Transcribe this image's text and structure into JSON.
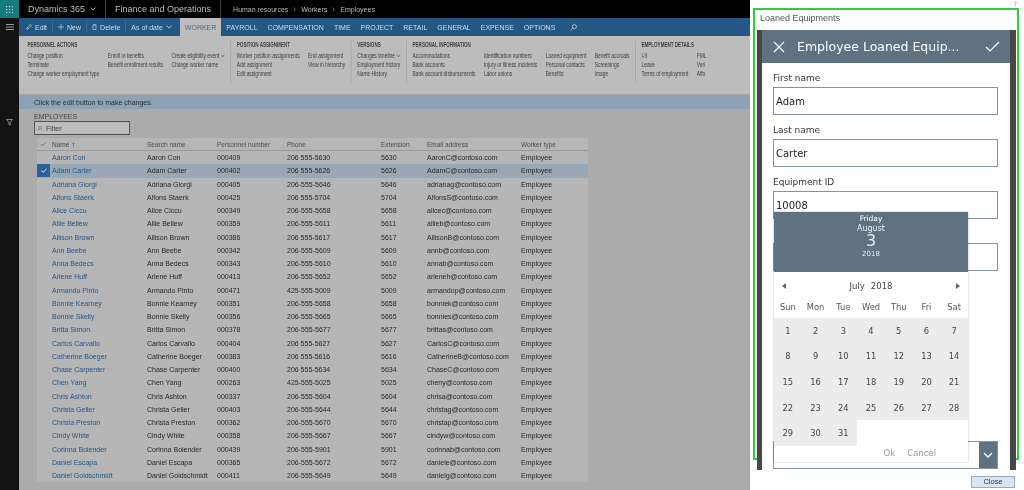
{
  "top_bar": {
    "app": "Dynamics 365",
    "module": "Finance and Operations",
    "breadcrumb": [
      "Human resources",
      "Workers",
      "Employees"
    ]
  },
  "action_bar": {
    "commands": [
      {
        "label": "Edit",
        "menu": false
      },
      {
        "label": "New",
        "menu": false
      },
      {
        "label": "Delete",
        "menu": false
      },
      {
        "label": "As of date",
        "menu": true
      }
    ],
    "tabs": [
      {
        "label": "WORKER",
        "selected": true
      },
      {
        "label": "PAYROLL",
        "selected": false
      },
      {
        "label": "COMPENSATION",
        "selected": false
      },
      {
        "label": "TIME",
        "selected": false
      },
      {
        "label": "PROJECT",
        "selected": false
      },
      {
        "label": "RETAIL",
        "selected": false
      },
      {
        "label": "GENERAL",
        "selected": false
      },
      {
        "label": "EXPENSE",
        "selected": false
      },
      {
        "label": "OPTIONS",
        "selected": false
      }
    ]
  },
  "ribbon": {
    "groups": [
      {
        "title": "PERSONNEL ACTIONS",
        "columns": [
          [
            {
              "label": "Change position",
              "menu": false
            },
            {
              "label": "Terminate",
              "menu": false
            },
            {
              "label": "Change worker employment type",
              "menu": false
            }
          ],
          [
            {
              "label": "Enroll in benefits",
              "menu": false
            },
            {
              "label": "Benefit enrollment results",
              "menu": false
            }
          ],
          [
            {
              "label": "Create eligibility event",
              "menu": true
            },
            {
              "label": "Change worker name",
              "menu": false
            }
          ]
        ]
      },
      {
        "title": "POSITION ASSIGNMENT",
        "columns": [
          [
            {
              "label": "Worker position assignments",
              "menu": false
            },
            {
              "label": "Add assignment",
              "menu": false
            },
            {
              "label": "Edit assignment",
              "menu": false
            }
          ],
          [
            {
              "label": "End assignment",
              "menu": false
            },
            {
              "label": "View in hierarchy",
              "menu": false
            }
          ]
        ]
      },
      {
        "title": "VERSIONS",
        "columns": [
          [
            {
              "label": "Changes timeline",
              "menu": true
            },
            {
              "label": "Employment history",
              "menu": false
            },
            {
              "label": "Name History",
              "menu": false
            }
          ]
        ]
      },
      {
        "title": "PERSONAL INFORMATION",
        "columns": [
          [
            {
              "label": "Accommodations",
              "menu": false
            },
            {
              "label": "Bank accounts",
              "menu": false
            },
            {
              "label": "Bank account disbursements",
              "menu": false
            }
          ],
          [
            {
              "label": "Identification numbers",
              "menu": false
            },
            {
              "label": "Injury or illness incidents",
              "menu": false
            },
            {
              "label": "Labor unions",
              "menu": false
            }
          ],
          [
            {
              "label": "Loaned equipment",
              "menu": false
            },
            {
              "label": "Personal contacts",
              "menu": false
            },
            {
              "label": "Benefits",
              "menu": false
            }
          ],
          [
            {
              "label": "Benefit accruals",
              "menu": false
            },
            {
              "label": "Screenings",
              "menu": false
            },
            {
              "label": "Image",
              "menu": false
            }
          ]
        ]
      },
      {
        "title": "EMPLOYMENT DETAILS",
        "columns": [
          [
            {
              "label": "I-9",
              "menu": false
            },
            {
              "label": "Leave",
              "menu": false
            },
            {
              "label": "Terms of employment",
              "menu": false
            }
          ],
          [
            {
              "label": "FML",
              "menu": false
            },
            {
              "label": "Veri",
              "menu": false
            },
            {
              "label": "Affo",
              "menu": false
            }
          ]
        ]
      }
    ]
  },
  "message": "Click the edit button to make changes.",
  "employees": {
    "title": "EMPLOYEES",
    "filter": {
      "placeholder": "Filter"
    },
    "columns": [
      {
        "label": "Name",
        "sorted": true
      },
      {
        "label": "Search name",
        "sorted": false
      },
      {
        "label": "Personnel number",
        "sorted": false
      },
      {
        "label": "Phone",
        "sorted": false
      },
      {
        "label": "Extension",
        "sorted": false
      },
      {
        "label": "Email address",
        "sorted": false
      },
      {
        "label": "Worker type",
        "sorted": false
      }
    ],
    "rows": [
      {
        "selected": false,
        "cells": [
          "Aaron Con",
          "Aaron Con",
          "000409",
          "206 555-5630",
          "5630",
          "AaronC@contoso.com",
          "Employee"
        ]
      },
      {
        "selected": true,
        "cells": [
          "Adam Carter",
          "Adam Carter",
          "000402",
          "206 555-5626",
          "5626",
          "AdamC@contoso.com",
          "Employee"
        ]
      },
      {
        "selected": false,
        "cells": [
          "Adriana Giorgi",
          "Adriana Giorgi",
          "000405",
          "206-555-5646",
          "5646",
          "adrianag@contoso.com",
          "Employee"
        ]
      },
      {
        "selected": false,
        "cells": [
          "Alfons Staerk",
          "Alfons Staerk",
          "000425",
          "206 555-5704",
          "5704",
          "AlfonsS@contoso.com",
          "Employee"
        ]
      },
      {
        "selected": false,
        "cells": [
          "Alice Ciccu",
          "Alice Ciccu",
          "000349",
          "206-555-5658",
          "5658",
          "alicec@contoso.com",
          "Employee"
        ]
      },
      {
        "selected": false,
        "cells": [
          "Allie Bellew",
          "Allie Bellew",
          "000359",
          "206-555-5611",
          "5611",
          "allieb@contoso.com",
          "Employee"
        ]
      },
      {
        "selected": false,
        "cells": [
          "Allison Brown",
          "Allison Brown",
          "000386",
          "206 555-5617",
          "5617",
          "AllisonB@contoso.com",
          "Employee"
        ]
      },
      {
        "selected": false,
        "cells": [
          "Ann Beebe",
          "Ann Beebe",
          "000342",
          "206-555-5609",
          "5609",
          "annb@contoso.com",
          "Employee"
        ]
      },
      {
        "selected": false,
        "cells": [
          "Anna Bedecs",
          "Anna Bedecs",
          "000343",
          "206-555-5610",
          "5610",
          "annab@contoso.com",
          "Employee"
        ]
      },
      {
        "selected": false,
        "cells": [
          "Arlene Huff",
          "Arlene Huff",
          "000413",
          "206-555-5652",
          "5652",
          "arleneh@contoso.com",
          "Employee"
        ]
      },
      {
        "selected": false,
        "cells": [
          "Armando Pinto",
          "Armando Pinto",
          "000471",
          "425-555-5009",
          "5009",
          "armandop@contoso.com",
          "Employee"
        ]
      },
      {
        "selected": false,
        "cells": [
          "Bonnie Kearney",
          "Bonnie Kearney",
          "000351",
          "206-555-5658",
          "5658",
          "bonniek@contoso.com",
          "Employee"
        ]
      },
      {
        "selected": false,
        "cells": [
          "Bonnie Skelly",
          "Bonnie Skelly",
          "000356",
          "206-555-5665",
          "5665",
          "bonnies@contoso.com",
          "Employee"
        ]
      },
      {
        "selected": false,
        "cells": [
          "Britta Simon",
          "Britta Simon",
          "000378",
          "206-555-5677",
          "5677",
          "brittas@contoso.com",
          "Employee"
        ]
      },
      {
        "selected": false,
        "cells": [
          "Carlos Carvallo",
          "Carlos Carvallo",
          "000404",
          "206 555-5627",
          "5627",
          "CarlosC@contoso.com",
          "Employee"
        ]
      },
      {
        "selected": false,
        "cells": [
          "Catherine Boeger",
          "Catherine Boeger",
          "000383",
          "206 555-5616",
          "5616",
          "CatherineB@contoso.com",
          "Employee"
        ]
      },
      {
        "selected": false,
        "cells": [
          "Chase Carpenter",
          "Chase Carpenter",
          "000400",
          "206 555-5634",
          "5634",
          "ChaseC@contoso.com",
          "Employee"
        ]
      },
      {
        "selected": false,
        "cells": [
          "Chen Yang",
          "Chen Yang",
          "000263",
          "425-555-5025",
          "5025",
          "cheny@contoso.com",
          "Employee"
        ]
      },
      {
        "selected": false,
        "cells": [
          "Chris Ashton",
          "Chris Ashton",
          "000337",
          "206-555-5604",
          "5604",
          "chrisa@contoso.com",
          "Employee"
        ]
      },
      {
        "selected": false,
        "cells": [
          "Christa Geller",
          "Christa Geller",
          "000403",
          "206-555-5644",
          "5644",
          "christag@contoso.com",
          "Employee"
        ]
      },
      {
        "selected": false,
        "cells": [
          "Christa Preston",
          "Christa Preston",
          "000362",
          "206-555-5670",
          "5670",
          "christap@contoso.com",
          "Employee"
        ]
      },
      {
        "selected": false,
        "cells": [
          "Cindy White",
          "Cindy White",
          "000358",
          "206-555-5667",
          "5667",
          "cindyw@contoso.com",
          "Employee"
        ]
      },
      {
        "selected": false,
        "cells": [
          "Corinna Bolender",
          "Corinna Bolender",
          "000439",
          "206-555-5901",
          "5901",
          "corinnab@contoso.com",
          "Employee"
        ]
      },
      {
        "selected": false,
        "cells": [
          "Daniel Escapa",
          "Daniel Escapa",
          "000365",
          "206-555-5672",
          "5672",
          "daniele@contoso.com",
          "Employee"
        ]
      },
      {
        "selected": false,
        "cells": [
          "Daniel Goldschmidt",
          "Daniel Goldschmidt",
          "000411",
          "206-555-5649",
          "5649",
          "danielg@contoso.com",
          "Employee"
        ]
      }
    ]
  },
  "panel": {
    "title": "Loaned Equipments",
    "help": "?",
    "app_title": "Employee Loaned Equip...",
    "fields": [
      {
        "label": "First name",
        "value": "Adam"
      },
      {
        "label": "Last name",
        "value": "Carter"
      },
      {
        "label": "Equipment ID",
        "value": "10008"
      }
    ],
    "date_picker": {
      "weekday": "Friday",
      "month": "August",
      "day": "3",
      "year": "2018",
      "nav_month": "July",
      "nav_year": "2018",
      "weekdays": [
        "Sun",
        "Mon",
        "Tue",
        "Wed",
        "Thu",
        "Fri",
        "Sat"
      ],
      "days": [
        "1",
        "2",
        "3",
        "4",
        "5",
        "6",
        "7",
        "8",
        "9",
        "10",
        "11",
        "12",
        "13",
        "14",
        "15",
        "16",
        "17",
        "18",
        "19",
        "20",
        "21",
        "22",
        "23",
        "24",
        "25",
        "26",
        "27",
        "28",
        "29",
        "30",
        "31"
      ],
      "buttons": [
        "Ok",
        "Cancel"
      ]
    },
    "close_button": "Close"
  }
}
